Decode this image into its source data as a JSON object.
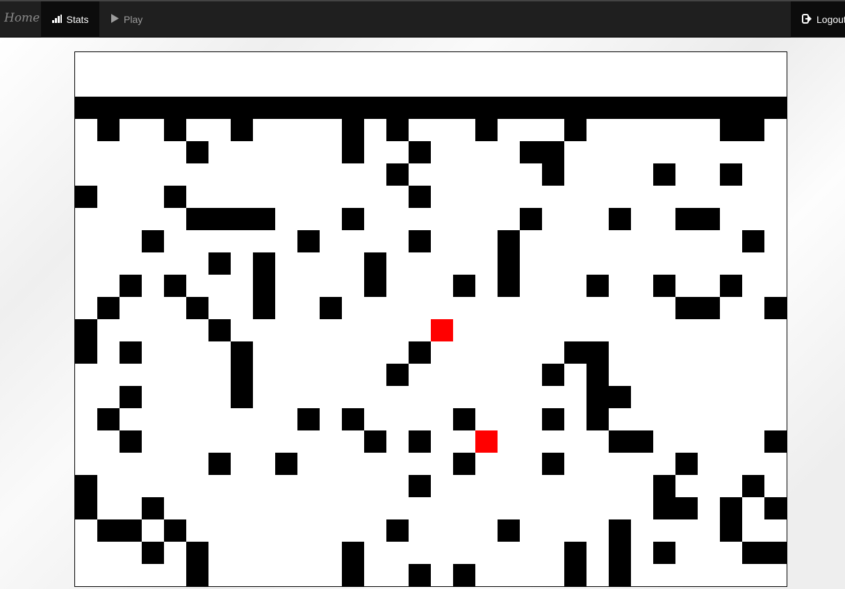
{
  "nav": {
    "brand": "Home",
    "stats_label": "Stats",
    "play_label": "Play",
    "logout_label": "Logout",
    "icons": {
      "stats": "bar-chart-icon",
      "play": "play-icon",
      "logout": "logout-icon"
    }
  },
  "board": {
    "columns": 32,
    "rows": 24,
    "colors": {
      "wall": "#000000",
      "target": "#ff0000",
      "empty": "#ffffff"
    },
    "wall_cells": [
      [
        2,
        0
      ],
      [
        2,
        1
      ],
      [
        2,
        2
      ],
      [
        2,
        3
      ],
      [
        2,
        4
      ],
      [
        2,
        5
      ],
      [
        2,
        6
      ],
      [
        2,
        7
      ],
      [
        2,
        8
      ],
      [
        2,
        9
      ],
      [
        2,
        10
      ],
      [
        2,
        11
      ],
      [
        2,
        12
      ],
      [
        2,
        13
      ],
      [
        2,
        14
      ],
      [
        2,
        15
      ],
      [
        2,
        16
      ],
      [
        2,
        17
      ],
      [
        2,
        18
      ],
      [
        2,
        19
      ],
      [
        2,
        20
      ],
      [
        2,
        21
      ],
      [
        2,
        22
      ],
      [
        2,
        23
      ],
      [
        2,
        24
      ],
      [
        2,
        25
      ],
      [
        2,
        26
      ],
      [
        2,
        27
      ],
      [
        2,
        28
      ],
      [
        2,
        29
      ],
      [
        2,
        30
      ],
      [
        2,
        31
      ],
      [
        3,
        1
      ],
      [
        3,
        4
      ],
      [
        3,
        7
      ],
      [
        3,
        12
      ],
      [
        3,
        14
      ],
      [
        3,
        18
      ],
      [
        3,
        22
      ],
      [
        3,
        29
      ],
      [
        3,
        30
      ],
      [
        4,
        5
      ],
      [
        4,
        12
      ],
      [
        4,
        15
      ],
      [
        4,
        20
      ],
      [
        4,
        21
      ],
      [
        5,
        14
      ],
      [
        5,
        21
      ],
      [
        5,
        26
      ],
      [
        5,
        29
      ],
      [
        6,
        0
      ],
      [
        6,
        4
      ],
      [
        6,
        15
      ],
      [
        7,
        5
      ],
      [
        7,
        6
      ],
      [
        7,
        7
      ],
      [
        7,
        8
      ],
      [
        7,
        12
      ],
      [
        7,
        20
      ],
      [
        7,
        24
      ],
      [
        7,
        27
      ],
      [
        7,
        28
      ],
      [
        8,
        3
      ],
      [
        8,
        10
      ],
      [
        8,
        15
      ],
      [
        8,
        19
      ],
      [
        8,
        30
      ],
      [
        9,
        6
      ],
      [
        9,
        8
      ],
      [
        9,
        13
      ],
      [
        9,
        19
      ],
      [
        10,
        2
      ],
      [
        10,
        4
      ],
      [
        10,
        8
      ],
      [
        10,
        13
      ],
      [
        10,
        17
      ],
      [
        10,
        19
      ],
      [
        10,
        23
      ],
      [
        10,
        26
      ],
      [
        10,
        29
      ],
      [
        11,
        1
      ],
      [
        11,
        5
      ],
      [
        11,
        8
      ],
      [
        11,
        11
      ],
      [
        11,
        27
      ],
      [
        11,
        28
      ],
      [
        11,
        31
      ],
      [
        12,
        0
      ],
      [
        12,
        6
      ],
      [
        13,
        0
      ],
      [
        13,
        2
      ],
      [
        13,
        7
      ],
      [
        13,
        15
      ],
      [
        13,
        22
      ],
      [
        13,
        23
      ],
      [
        14,
        7
      ],
      [
        14,
        14
      ],
      [
        14,
        21
      ],
      [
        14,
        23
      ],
      [
        15,
        2
      ],
      [
        15,
        7
      ],
      [
        15,
        23
      ],
      [
        15,
        24
      ],
      [
        16,
        1
      ],
      [
        16,
        10
      ],
      [
        16,
        12
      ],
      [
        16,
        17
      ],
      [
        16,
        21
      ],
      [
        16,
        23
      ],
      [
        17,
        2
      ],
      [
        17,
        13
      ],
      [
        17,
        15
      ],
      [
        17,
        24
      ],
      [
        17,
        25
      ],
      [
        17,
        31
      ],
      [
        18,
        6
      ],
      [
        18,
        9
      ],
      [
        18,
        17
      ],
      [
        18,
        21
      ],
      [
        18,
        27
      ],
      [
        19,
        0
      ],
      [
        19,
        15
      ],
      [
        19,
        26
      ],
      [
        19,
        30
      ],
      [
        20,
        0
      ],
      [
        20,
        3
      ],
      [
        20,
        26
      ],
      [
        20,
        27
      ],
      [
        20,
        29
      ],
      [
        20,
        31
      ],
      [
        21,
        1
      ],
      [
        21,
        2
      ],
      [
        21,
        4
      ],
      [
        21,
        14
      ],
      [
        21,
        19
      ],
      [
        21,
        24
      ],
      [
        21,
        29
      ],
      [
        22,
        3
      ],
      [
        22,
        5
      ],
      [
        22,
        12
      ],
      [
        22,
        22
      ],
      [
        22,
        24
      ],
      [
        22,
        26
      ],
      [
        22,
        30
      ],
      [
        22,
        31
      ],
      [
        23,
        5
      ],
      [
        23,
        12
      ],
      [
        23,
        15
      ],
      [
        23,
        17
      ],
      [
        23,
        22
      ],
      [
        23,
        24
      ]
    ],
    "target_cells": [
      [
        12,
        16
      ],
      [
        17,
        18
      ]
    ]
  }
}
